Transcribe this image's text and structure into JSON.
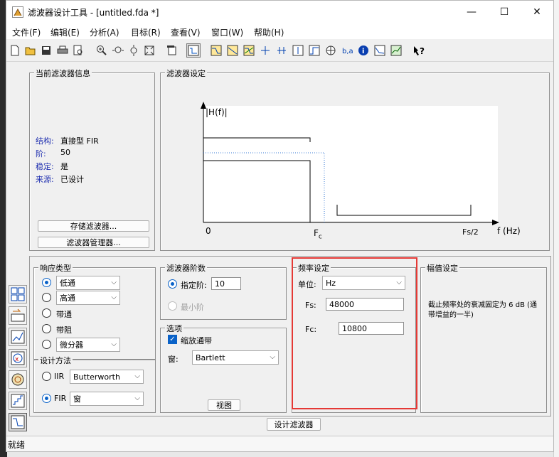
{
  "window": {
    "title": "滤波器设计工具 - [untitled.fda *]",
    "minimize": "—",
    "maximize": "☐",
    "close": "✕"
  },
  "menu": [
    "文件(F)",
    "编辑(E)",
    "分析(A)",
    "目标(R)",
    "查看(V)",
    "窗口(W)",
    "帮助(H)"
  ],
  "info_panel": {
    "title": "当前滤波器信息",
    "structure_label": "结构:",
    "structure_value": "直接型 FIR",
    "order_label": "阶:",
    "order_value": "50",
    "stable_label": "稳定:",
    "stable_value": "是",
    "source_label": "来源:",
    "source_value": "已设计",
    "store_button": "存储滤波器...",
    "manager_button": "滤波器管理器..."
  },
  "spec_panel": {
    "title": "滤波器设定",
    "y_label": "|H(f)|",
    "x_label": "f (Hz)",
    "x_zero": "0",
    "x_fc": "F",
    "x_fc_sub": "c",
    "x_fs2": "Fs/2"
  },
  "response": {
    "title": "响应类型",
    "lowpass_select": "低通",
    "highpass_select": "高通",
    "bandpass": "带通",
    "bandstop": "带阻",
    "differentiator_select": "微分器"
  },
  "design_method": {
    "title": "设计方法",
    "iir_label": "IIR",
    "iir_select": "Butterworth",
    "fir_label": "FIR",
    "fir_select": "窗"
  },
  "order": {
    "title": "滤波器阶数",
    "specify_label": "指定阶:",
    "specify_value": "10",
    "minimum_label": "最小阶"
  },
  "options": {
    "title": "选项",
    "scale_label": "缩放通带",
    "window_label": "窗:",
    "window_select": "Bartlett",
    "view_button": "视图"
  },
  "freq": {
    "title": "频率设定",
    "unit_label": "单位:",
    "unit_select": "Hz",
    "fs_label": "Fs:",
    "fs_value": "48000",
    "fc_label": "Fc:",
    "fc_value": "10800"
  },
  "mag": {
    "title": "幅值设定",
    "note": "截止频率处的衰减固定为 6 dB (通带增益的一半)"
  },
  "design_button": "设计滤波器",
  "status": "就绪",
  "colors": {
    "highlight": "#e53935",
    "dotted": "#3a7bd5",
    "radio_blue": "#0a62c8"
  }
}
